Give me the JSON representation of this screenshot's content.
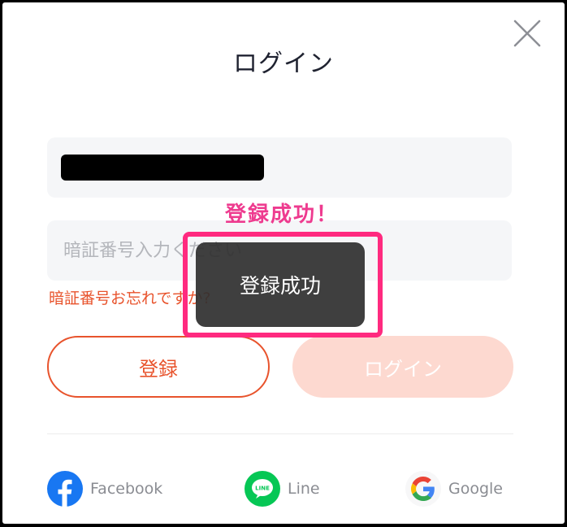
{
  "dialog": {
    "title": "ログイン",
    "close_icon": "close-icon"
  },
  "form": {
    "username_value": "",
    "password_placeholder": "暗証番号入力ください",
    "forgot_password": "暗証番号お忘れですか?",
    "register_label": "登録",
    "login_label": "ログイン"
  },
  "social": {
    "facebook": {
      "label": "Facebook",
      "icon": "facebook-icon",
      "color": "#1877f2"
    },
    "line": {
      "label": "Line",
      "icon": "line-icon",
      "color": "#06c755"
    },
    "google": {
      "label": "Google",
      "icon": "google-icon"
    }
  },
  "annotation": {
    "text": "登録成功！",
    "color": "#ee3b8f"
  },
  "toast": {
    "message": "登録成功"
  },
  "colors": {
    "accent": "#e8532c",
    "login_disabled_bg": "#fdd9d0",
    "highlight": "#ff2a7f"
  }
}
